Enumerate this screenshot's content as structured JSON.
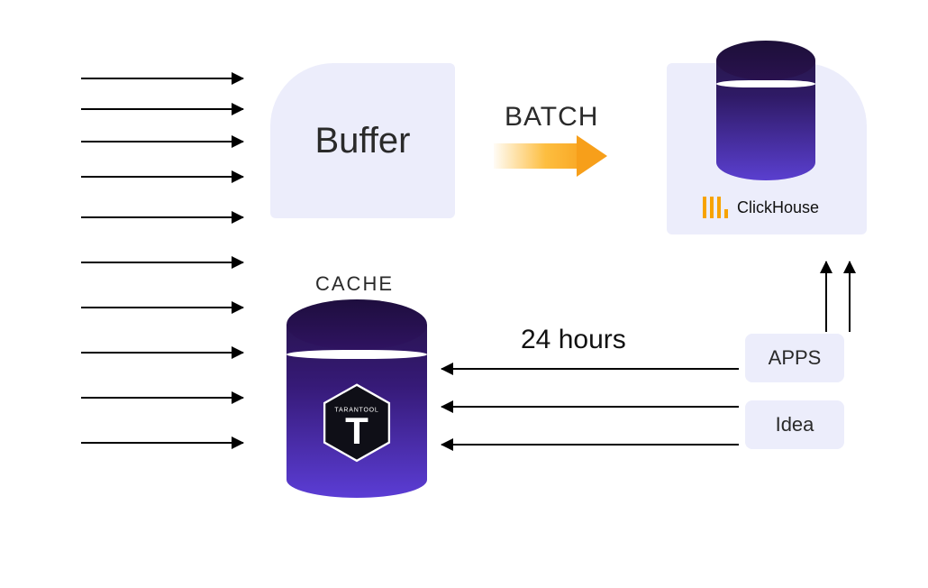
{
  "buffer": {
    "label": "Buffer"
  },
  "batch": {
    "label": "BATCH"
  },
  "clickhouse": {
    "name": "ClickHouse"
  },
  "cache": {
    "label": "CACHE"
  },
  "hours": {
    "label": "24 hours"
  },
  "apps": {
    "label": "APPS"
  },
  "idea": {
    "label": "Idea"
  },
  "tarantool": {
    "letter": "T",
    "brand_text": "TARANTOOL"
  }
}
